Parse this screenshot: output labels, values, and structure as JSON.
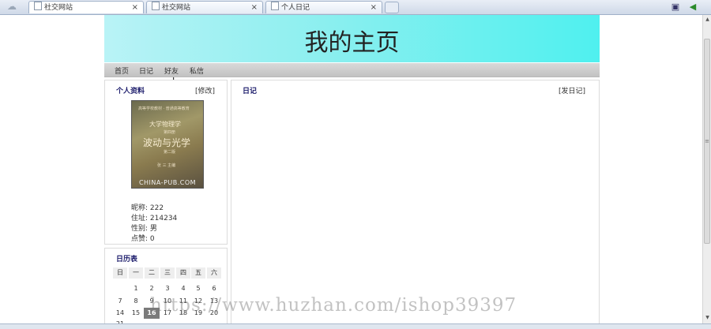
{
  "browser": {
    "tabs": [
      {
        "label": "社交网站",
        "active": true
      },
      {
        "label": "社交网站",
        "active": false
      },
      {
        "label": "个人日记",
        "active": false
      }
    ],
    "close_glyph": "×"
  },
  "page": {
    "title": "我的主页",
    "nav": [
      "首页",
      "日记",
      "好友",
      "私信"
    ]
  },
  "profile": {
    "heading": "个人资料",
    "edit_link": "[修改]",
    "book": {
      "small_top": "高等学校教材 · 普通高等教育",
      "line1": "大学物理学",
      "line2": "第四册",
      "line3": "波动与光学",
      "line4": "第二版",
      "author": "张 三 主编",
      "bottom": "CHINA-PUB.COM"
    },
    "fields": [
      {
        "label": "昵称:",
        "value": "222"
      },
      {
        "label": "住址:",
        "value": "214234"
      },
      {
        "label": "性别:",
        "value": "男"
      },
      {
        "label": "点赞:",
        "value": "0"
      }
    ]
  },
  "calendar": {
    "heading": "日历表",
    "weekdays": [
      "日",
      "一",
      "二",
      "三",
      "四",
      "五",
      "六"
    ],
    "weeks": [
      [
        "",
        "1",
        "2",
        "3",
        "4",
        "5",
        "6",
        "7"
      ],
      [
        "8",
        "9",
        "10",
        "11",
        "12",
        "13",
        "14"
      ],
      [
        "15",
        "16",
        "17",
        "18",
        "19",
        "20",
        "21"
      ]
    ],
    "today": "17"
  },
  "diary": {
    "heading": "日记",
    "post_link": "[发日记]"
  },
  "watermark": "https://www.huzhan.com/ishop39397",
  "colors": {
    "banner_start": "#b9f3f6",
    "banner_end": "#4ff0ef",
    "heading": "#1a1a6a",
    "today_bg": "#7b7b7b"
  }
}
